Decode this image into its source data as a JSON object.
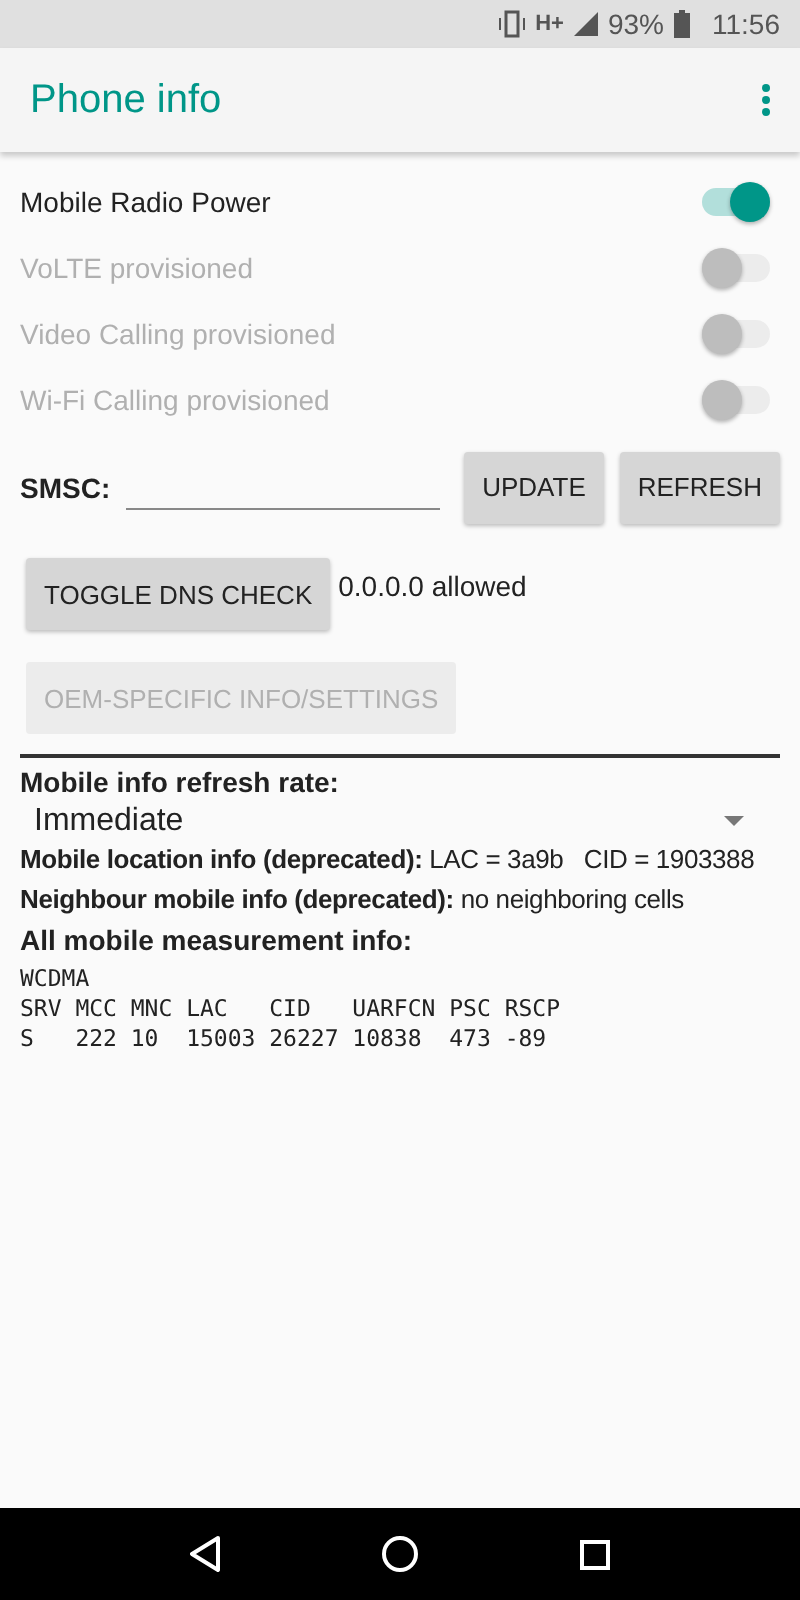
{
  "status_bar": {
    "network": "H+",
    "battery": "93%",
    "time": "11:56"
  },
  "app_bar": {
    "title": "Phone info"
  },
  "switches": [
    {
      "label": "Mobile Radio Power",
      "on": true,
      "disabled": false
    },
    {
      "label": "VoLTE provisioned",
      "on": false,
      "disabled": true
    },
    {
      "label": "Video Calling provisioned",
      "on": false,
      "disabled": true
    },
    {
      "label": "Wi-Fi Calling provisioned",
      "on": false,
      "disabled": true
    }
  ],
  "smsc": {
    "label": "SMSC:",
    "buttons": [
      {
        "label": "UPDATE",
        "disabled": false
      },
      {
        "label": "REFRESH",
        "disabled": false
      }
    ]
  },
  "dns": {
    "button": {
      "label": "TOGGLE DNS CHECK",
      "disabled": false
    },
    "status": "0.0.0.0 allowed"
  },
  "oem_button": {
    "label": "OEM-SPECIFIC INFO/SETTINGS",
    "disabled": true
  },
  "refresh_rate": {
    "label": "Mobile info refresh rate:",
    "value": "Immediate"
  },
  "info": [
    {
      "label": "Mobile location info (deprecated):",
      "value": "LAC = 3a9b   CID = 1903388"
    },
    {
      "label": "Neighbour mobile info (deprecated):",
      "value": "no neighboring cells"
    }
  ],
  "measurement": {
    "label": "All mobile measurement info:",
    "lines": [
      "WCDMA",
      "SRV MCC MNC LAC   CID   UARFCN PSC RSCP",
      "S   222 10  15003 26227 10838  473 -89"
    ]
  }
}
